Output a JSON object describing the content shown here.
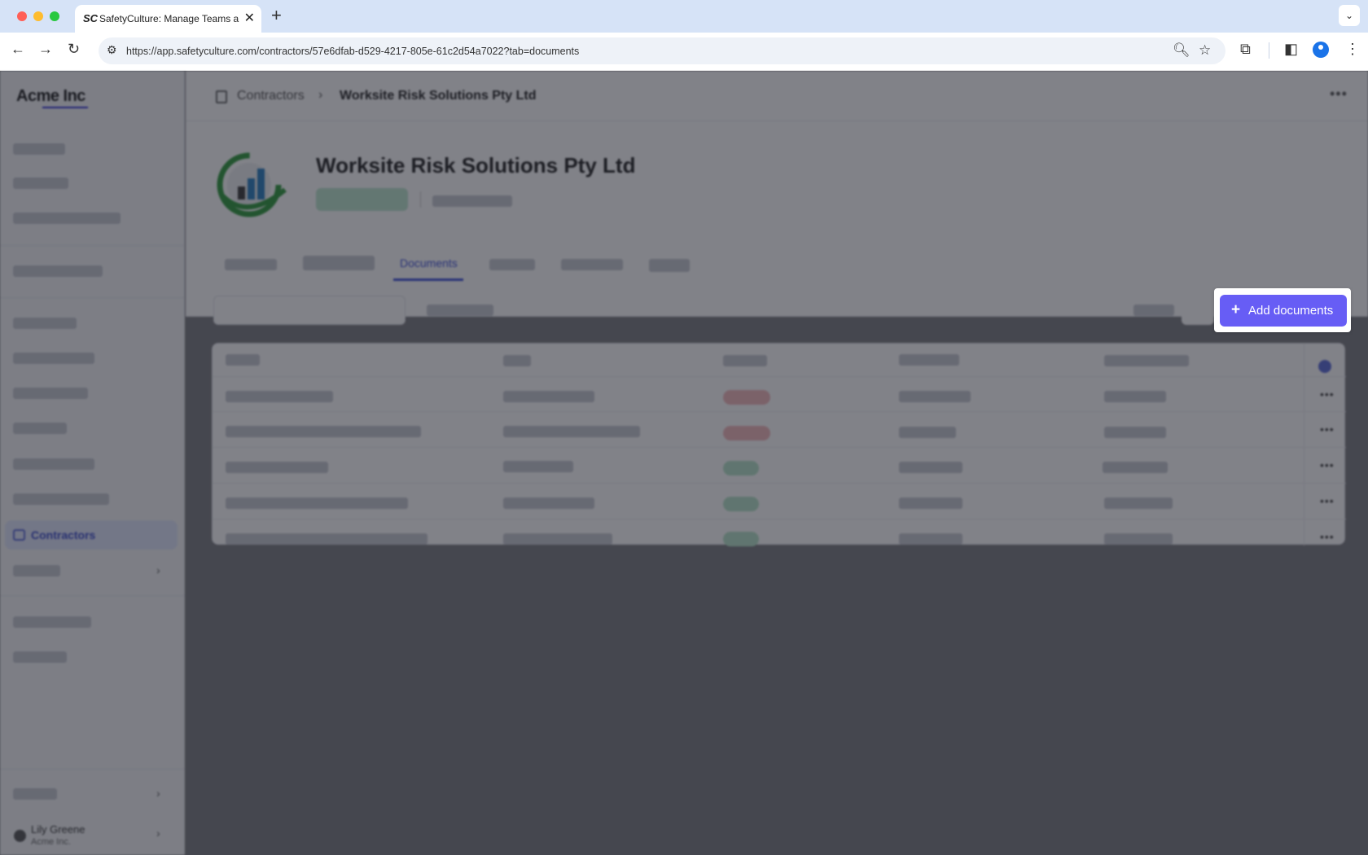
{
  "browser": {
    "tab_title": "SafetyCulture: Manage Teams and...",
    "tab_favicon": "SC",
    "url": "https://app.safetyculture.com/contractors/57e6dfab-d529-4217-805e-61c2d54a7022?tab=documents"
  },
  "sidebar": {
    "brand": "Acme Inc",
    "active_item": "Contractors",
    "user_name": "Lily Greene",
    "user_org": "Acme Inc."
  },
  "breadcrumb": {
    "parent": "Contractors",
    "current": "Worksite Risk Solutions Pty Ltd"
  },
  "profile": {
    "company_name": "Worksite Risk Solutions Pty Ltd"
  },
  "tabs": {
    "active": "Documents"
  },
  "actions": {
    "add_documents": "Add documents"
  },
  "colors": {
    "accent": "#675df5",
    "active_nav": "#3b4ccc",
    "status_red": "#f2b8bb",
    "status_green": "#b6e3c9"
  }
}
